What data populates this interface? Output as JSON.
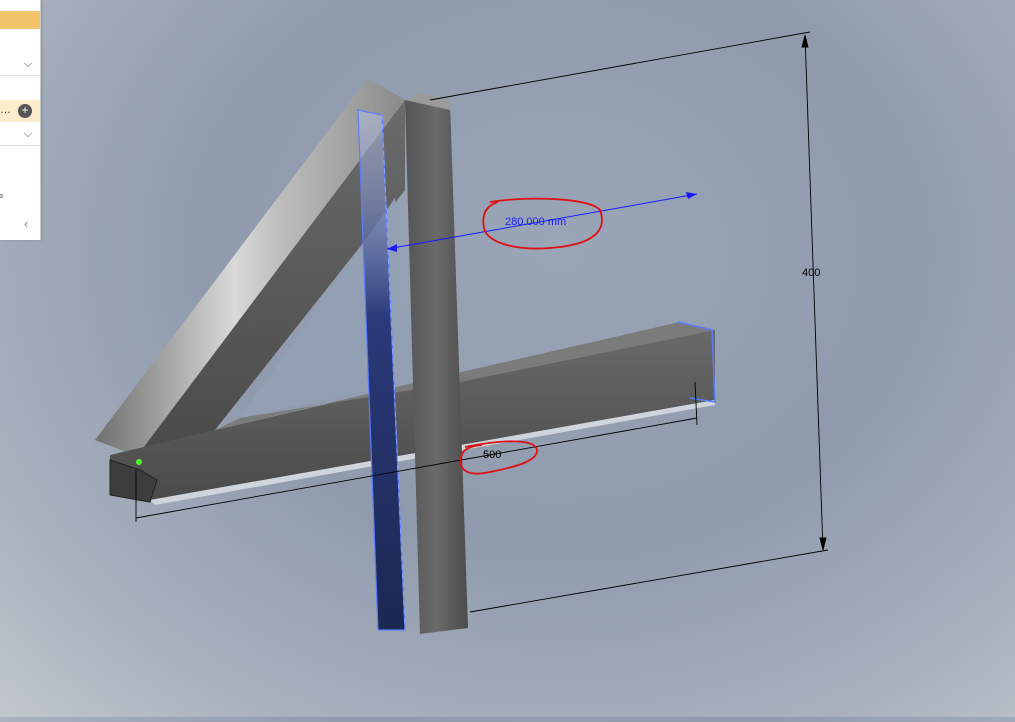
{
  "side_panel": {
    "field_text": "…",
    "add_button_icon": "plus-circle-icon",
    "unit_text": "²",
    "chevron_glyph": "⌵",
    "collapse_glyph": "‹"
  },
  "viewport": {
    "dimension_top_label": "280.000 mm",
    "dimension_bottom_label": "500",
    "dimension_vertical_label": "400",
    "model": "number-4-square-tube-frame",
    "annotation_color": "#e01010",
    "dimension_color": "#1a1aff"
  }
}
